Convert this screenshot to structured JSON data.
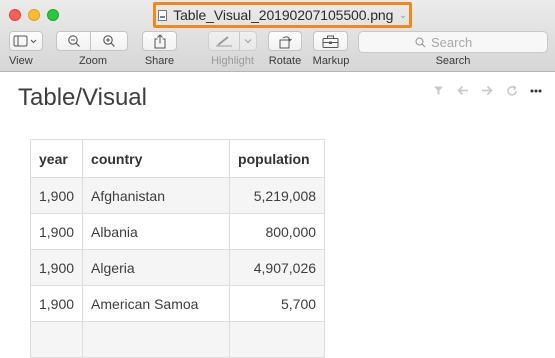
{
  "window": {
    "title": "Table_Visual_20190207105500.png"
  },
  "toolbar": {
    "view_label": "View",
    "zoom_label": "Zoom",
    "share_label": "Share",
    "highlight_label": "Highlight",
    "rotate_label": "Rotate",
    "markup_label": "Markup",
    "search_label": "Search",
    "search_placeholder": "Search"
  },
  "page": {
    "title": "Table/Visual",
    "controls": [
      "filter-icon",
      "back-arrow-icon",
      "forward-arrow-icon",
      "refresh-icon",
      "more-icon"
    ]
  },
  "table": {
    "headers": [
      "year",
      "country",
      "population"
    ],
    "rows": [
      [
        "1,900",
        "Afghanistan",
        "5,219,008"
      ],
      [
        "1,900",
        "Albania",
        "800,000"
      ],
      [
        "1,900",
        "Algeria",
        "4,907,026"
      ],
      [
        "1,900",
        "American Samoa",
        "5,700"
      ],
      [
        "",
        "",
        ""
      ]
    ]
  },
  "colors": {
    "highlight_border": "#f0891a",
    "close": "#fc5f57",
    "minimize": "#fdbc2e",
    "zoom": "#28c840"
  }
}
